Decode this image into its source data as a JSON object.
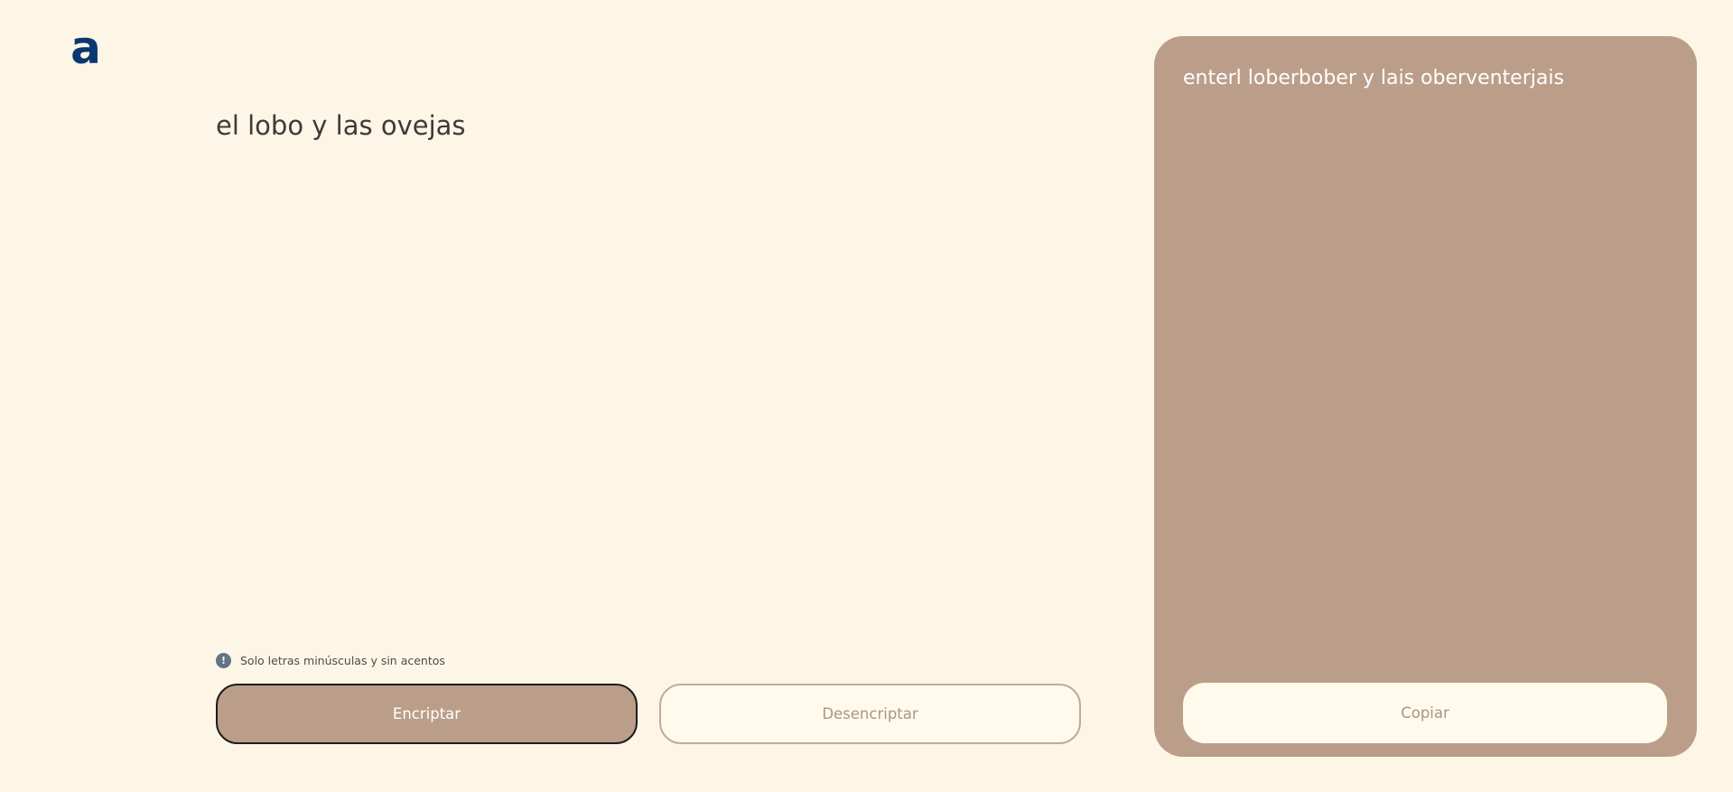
{
  "logo": {
    "icon": "letter-a-logo",
    "letter": "a",
    "color": "#0a3871"
  },
  "input": {
    "value": "el lobo y las ovejas"
  },
  "hint": {
    "icon": "exclamation-circle-icon",
    "text": "Solo letras minúsculas y sin acentos"
  },
  "buttons": {
    "encrypt_label": "Encriptar",
    "decrypt_label": "Desencriptar"
  },
  "output": {
    "text": "enterl loberbober y lais oberventerjais",
    "copy_label": "Copiar"
  },
  "colors": {
    "background": "#fdf6e6",
    "accent": "#bb9e89",
    "button_light": "#fffaeb",
    "logo_blue": "#0a3871"
  }
}
